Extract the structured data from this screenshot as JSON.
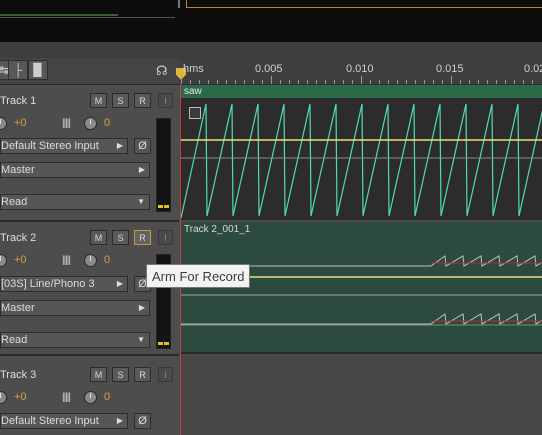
{
  "ruler": {
    "labels": [
      "hms",
      "0.005",
      "0.010",
      "0.015",
      "0.02"
    ]
  },
  "clip1": {
    "name": "saw"
  },
  "clip2": {
    "name": "Track 2_001_1"
  },
  "toolbar_icons": [
    "arrow-icon",
    "branch-icon",
    "level-bars-icon"
  ],
  "tracks": [
    {
      "name": "Track 1",
      "volume": "+0",
      "pan": "0",
      "input": "Default Stereo Input",
      "output": "Master",
      "automation": "Read"
    },
    {
      "name": "Track 2",
      "volume": "+0",
      "pan": "0",
      "input": "[03S] Line/Phono 3",
      "output": "Master",
      "automation": "Read"
    },
    {
      "name": "Track 3",
      "volume": "+0",
      "pan": "0",
      "input": "Default Stereo Input"
    }
  ],
  "buttons": {
    "mute": "M",
    "solo": "S",
    "arm": "R",
    "input_monitor": "I"
  },
  "tooltip": {
    "text": "Arm For Record"
  },
  "colors": {
    "clip_header": "#2d6a4a",
    "waveform": "#4fdcb6",
    "volume_line": "#e8e07a",
    "playhead": "#d03a3a",
    "value_text": "#d8a33a",
    "record_highlight": "#c89b3a"
  }
}
